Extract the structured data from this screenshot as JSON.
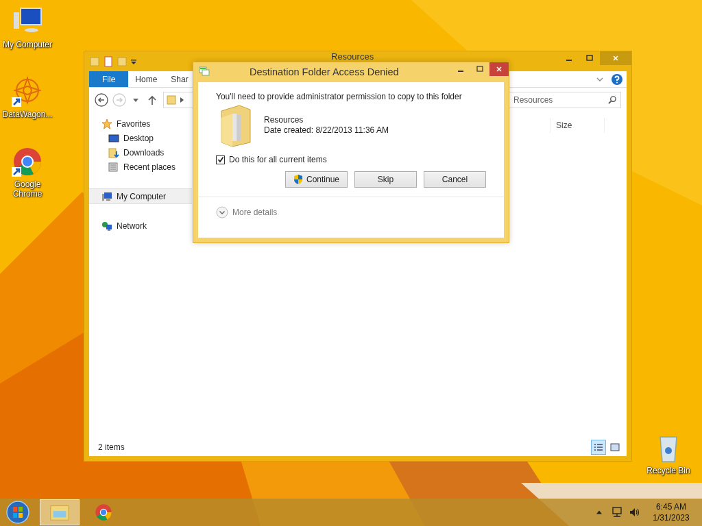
{
  "desktop_icons": [
    {
      "label": "My Computer",
      "kind": "computer",
      "shortcut": false
    },
    {
      "label": "DataWagon...",
      "kind": "app",
      "shortcut": true
    },
    {
      "label": "Google Chrome",
      "kind": "browser",
      "shortcut": true
    },
    {
      "label": "Recycle Bin",
      "kind": "recycle-bin",
      "shortcut": false
    }
  ],
  "explorer": {
    "title": "Resources",
    "ribbon_tabs": [
      {
        "label": "File",
        "selected": true
      },
      {
        "label": "Home",
        "selected": false
      },
      {
        "label": "Shar",
        "selected": false
      }
    ],
    "search": {
      "placeholder": "Resources"
    },
    "columns": [
      "Size"
    ],
    "nav": [
      {
        "label": "Favorites",
        "kind": "star",
        "selected": false,
        "children": [
          {
            "label": "Desktop",
            "kind": "desktop",
            "selected": false
          },
          {
            "label": "Downloads",
            "kind": "downloads",
            "selected": false
          },
          {
            "label": "Recent places",
            "kind": "recent",
            "selected": false
          }
        ]
      },
      {
        "label": "My Computer",
        "kind": "computer",
        "selected": true
      },
      {
        "label": "Network",
        "kind": "network",
        "selected": false
      }
    ],
    "status": "2 items",
    "views": [
      {
        "kind": "details",
        "selected": true
      },
      {
        "kind": "large",
        "selected": false
      }
    ]
  },
  "dialog": {
    "title": "Destination Folder Access Denied",
    "message": "You'll need to provide administrator permission to copy to this folder",
    "item": {
      "name": "Resources",
      "date": "Date created: 8/22/2013 11:36 AM"
    },
    "checkbox": {
      "label": "Do this for all current items",
      "checked": true
    },
    "buttons": [
      {
        "label": "Continue",
        "shield": true
      },
      {
        "label": "Skip",
        "shield": false
      },
      {
        "label": "Cancel",
        "shield": false
      }
    ],
    "more_details": "More details"
  },
  "taskbar": {
    "apps": [
      {
        "kind": "explorer",
        "selected": true
      },
      {
        "kind": "chrome",
        "selected": false
      }
    ],
    "time": "6:45 AM",
    "date": "1/31/2023"
  }
}
